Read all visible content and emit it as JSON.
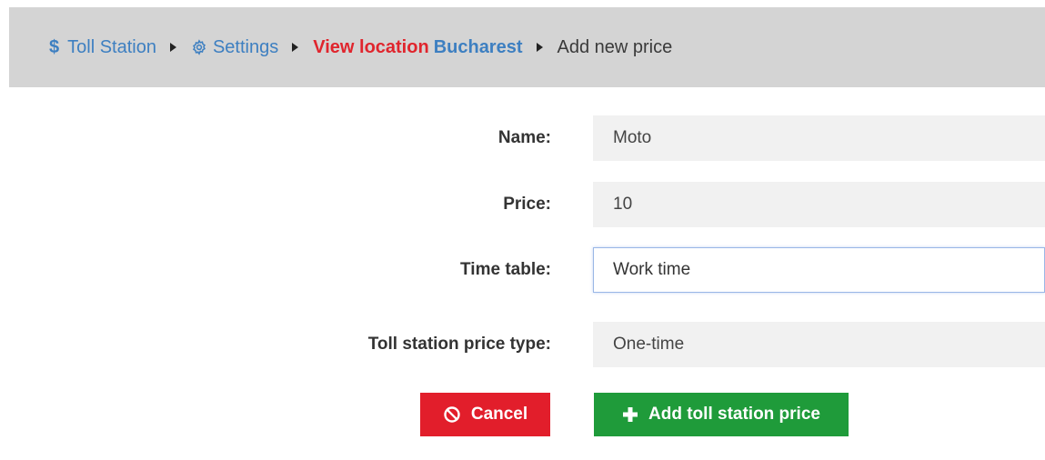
{
  "breadcrumb": {
    "home_label": "Toll Station",
    "settings_label": "Settings",
    "location_prefix": "View location",
    "location_name": "Bucharest",
    "current_label": "Add new price"
  },
  "form": {
    "fields": [
      {
        "label": "Name:",
        "value": "Moto"
      },
      {
        "label": "Price:",
        "value": "10"
      },
      {
        "label": "Time table:",
        "value": "Work time"
      },
      {
        "label": "Toll station price type:",
        "value": "One-time"
      }
    ]
  },
  "actions": {
    "cancel_label": "Cancel",
    "add_label": "Add toll station price"
  },
  "icons": {
    "home": "dollar-icon",
    "settings": "gear-icon",
    "cancel": "ban-icon",
    "add": "plus-icon"
  },
  "colors": {
    "link": "#3d7fc1",
    "breadcrumb_highlight": "#e0252d",
    "cancel_button": "#e21e2b",
    "add_button": "#1f9b3a",
    "breadcrumb_bg": "#d4d4d4"
  }
}
